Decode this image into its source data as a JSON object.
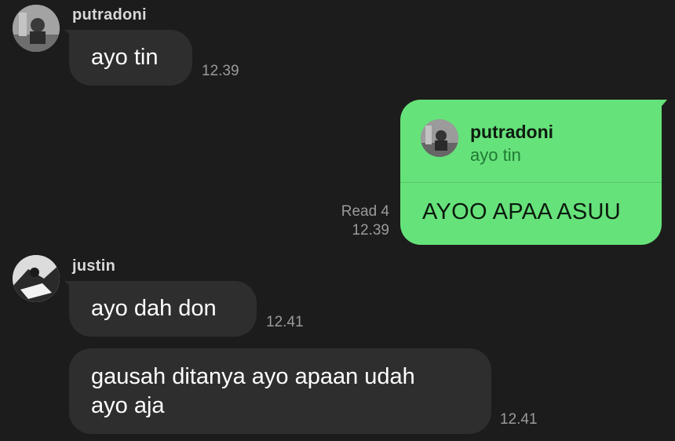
{
  "messages": {
    "m1": {
      "sender": "putradoni",
      "text": "ayo tin",
      "time": "12.39"
    },
    "m2": {
      "reply_to": {
        "name": "putradoni",
        "text": "ayo tin"
      },
      "text": "AYOO APAA ASUU",
      "read": "Read 4",
      "time": "12.39"
    },
    "m3": {
      "sender": "justin",
      "text": "ayo dah don",
      "time": "12.41"
    },
    "m4": {
      "text_line1": "gausah ditanya ayo apaan udah",
      "text_line2": "ayo aja",
      "time": "12.41"
    }
  },
  "colors": {
    "background": "#1c1c1c",
    "incoming_bubble": "#2e2e2e",
    "outgoing_bubble": "#66e27a"
  },
  "icons": {
    "avatar_putradoni": "avatar-photo",
    "avatar_justin": "avatar-photo"
  }
}
